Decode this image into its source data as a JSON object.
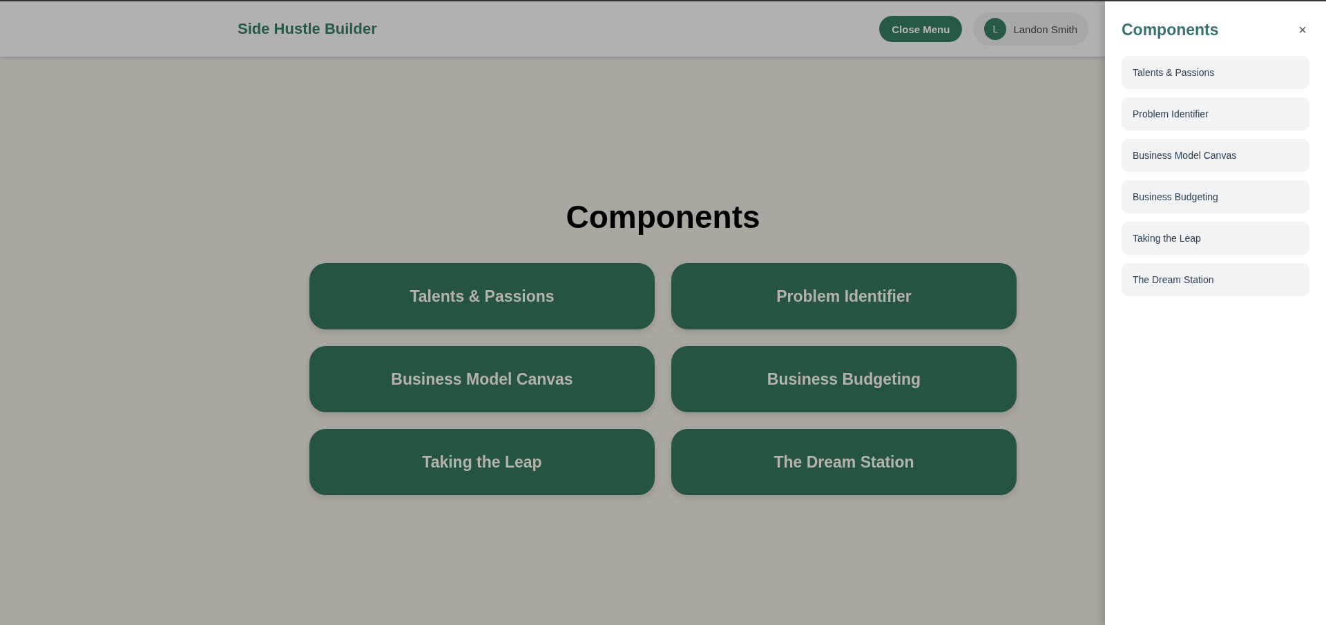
{
  "header": {
    "title": "Side Hustle Builder",
    "close_button": "Close Menu",
    "user": {
      "initial": "L",
      "name": "Landon Smith"
    }
  },
  "main": {
    "heading": "Components",
    "cards": [
      {
        "label": "Talents & Passions"
      },
      {
        "label": "Problem Identifier"
      },
      {
        "label": "Business Model Canvas"
      },
      {
        "label": "Business Budgeting"
      },
      {
        "label": "Taking the Leap"
      },
      {
        "label": "The Dream Station"
      }
    ]
  },
  "sidebar": {
    "title": "Components",
    "close": "×",
    "items": [
      {
        "label": "Talents & Passions"
      },
      {
        "label": "Problem Identifier"
      },
      {
        "label": "Business Model Canvas"
      },
      {
        "label": "Business Budgeting"
      },
      {
        "label": "Taking the Leap"
      },
      {
        "label": "The Dream Station"
      }
    ]
  }
}
